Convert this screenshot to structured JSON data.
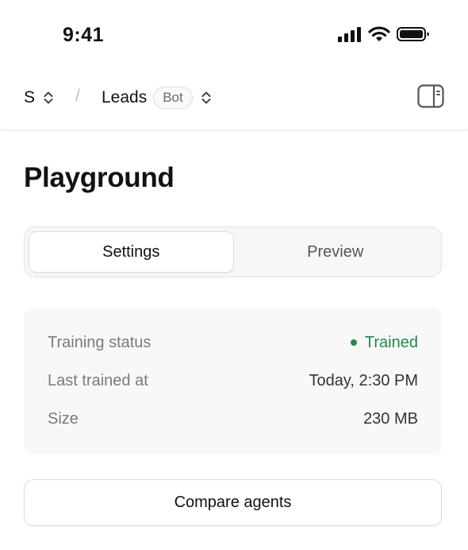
{
  "status_bar": {
    "time": "9:41",
    "icons": [
      "cellular-signal-icon",
      "wifi-icon",
      "battery-icon"
    ]
  },
  "topbar": {
    "workspace": "S",
    "separator": "/",
    "agent_name": "Leads",
    "agent_badge": "Bot",
    "icons": [
      "chevron-up-down-icon",
      "sidebar-panel-icon"
    ]
  },
  "page": {
    "title": "Playground"
  },
  "tabs": [
    {
      "label": "Settings",
      "active": true
    },
    {
      "label": "Preview",
      "active": false
    }
  ],
  "info": {
    "rows": [
      {
        "label": "Training status",
        "value": "Trained"
      },
      {
        "label": "Last trained at",
        "value": "Today, 2:30 PM"
      },
      {
        "label": "Size",
        "value": "230 MB"
      }
    ]
  },
  "actions": {
    "compare_label": "Compare agents"
  },
  "colors": {
    "success": "#1f8a4c",
    "card_bg": "#f8f8f8",
    "tab_track": "#f7f7f7"
  }
}
